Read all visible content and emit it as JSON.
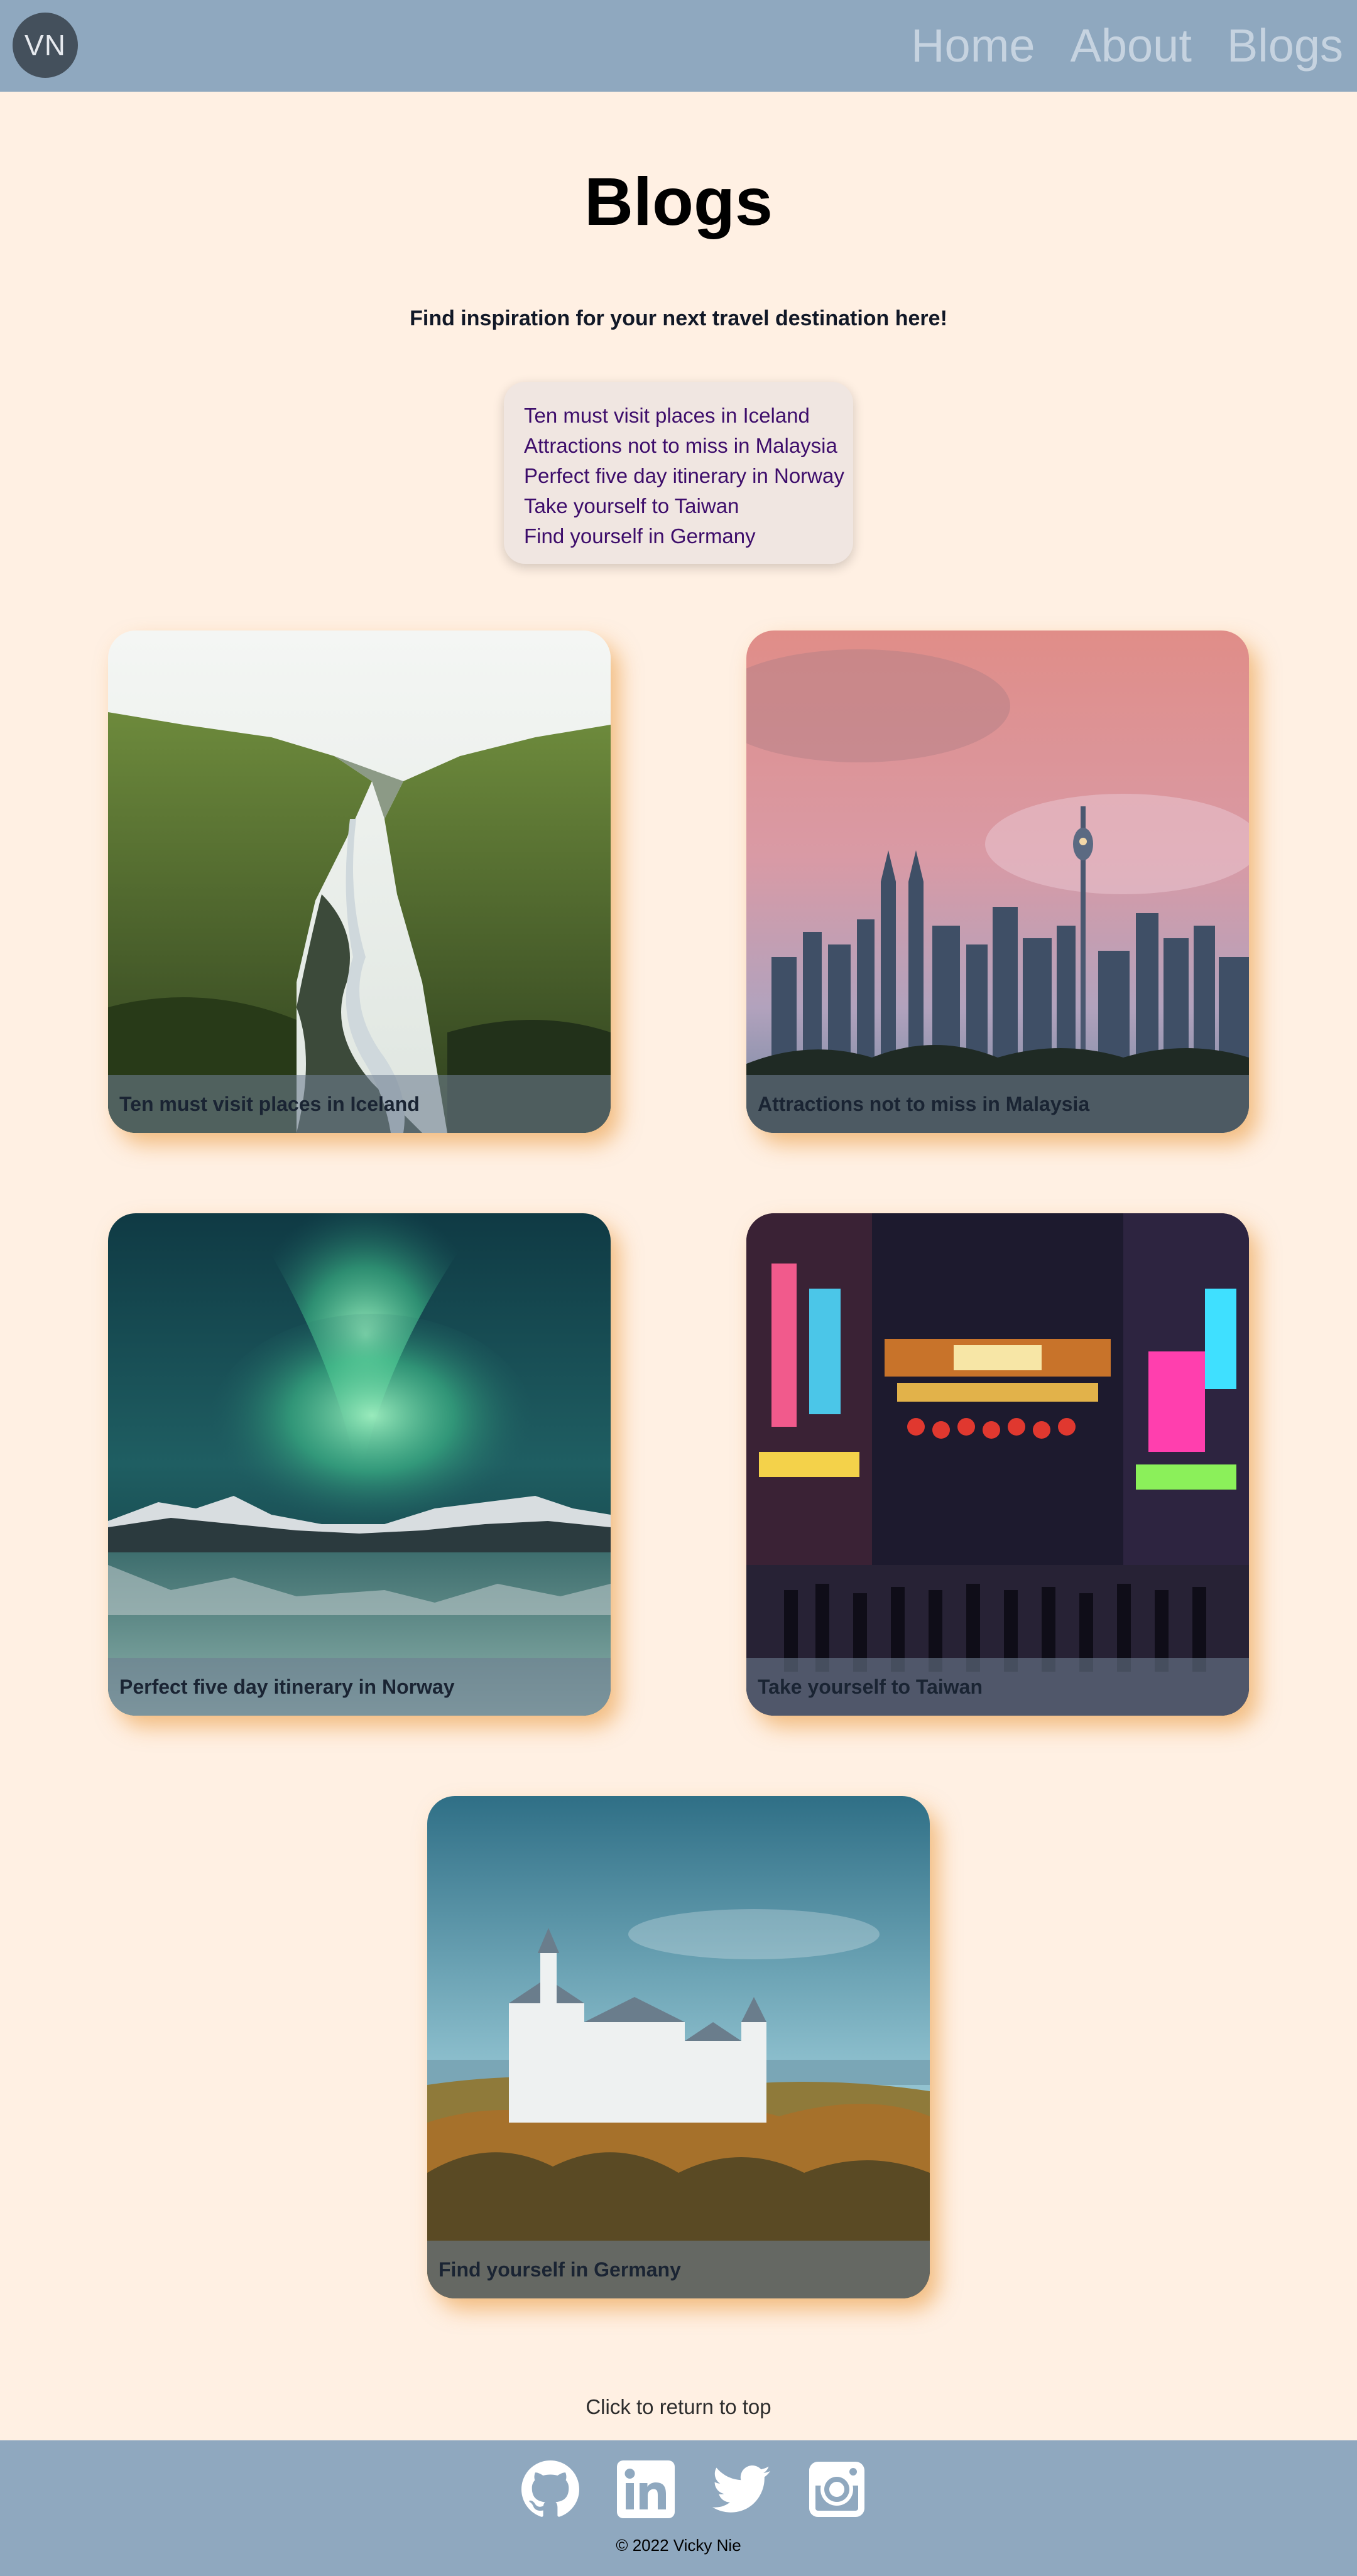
{
  "header": {
    "logo_text": "VN",
    "nav": [
      {
        "label": "Home"
      },
      {
        "label": "About"
      },
      {
        "label": "Blogs"
      }
    ]
  },
  "main": {
    "title": "Blogs",
    "subtitle": "Find inspiration for your next travel destination here!",
    "toc": [
      "Ten must visit places in Iceland",
      "Attractions not to miss in Malaysia",
      "Perfect five day itinerary in Norway",
      "Take yourself to Taiwan",
      "Find yourself in Germany"
    ],
    "cards": [
      {
        "caption": "Ten must visit places in Iceland",
        "image": "icelandic-canyon-river-photo"
      },
      {
        "caption": "Attractions not to miss in Malaysia",
        "image": "kuala-lumpur-skyline-sunset-photo"
      },
      {
        "caption": "Perfect five day itinerary in Norway",
        "image": "northern-lights-lake-photo"
      },
      {
        "caption": "Take yourself to Taiwan",
        "image": "neon-night-market-street-photo"
      },
      {
        "caption": "Find yourself in Germany",
        "image": "castle-on-forest-hill-photo"
      }
    ],
    "return_top": "Click to return to top"
  },
  "footer": {
    "social": [
      "github-icon",
      "linkedin-icon",
      "twitter-icon",
      "instagram-icon"
    ],
    "copyright": "© 2022 Vicky Nie"
  },
  "colors": {
    "header_bg": "#8fa8bf",
    "page_bg": "#fff0e3",
    "logo_bg": "#44505c",
    "nav_text": "#c6d3e0",
    "link": "#3d0d6b",
    "card_shadow": "#e89230"
  }
}
